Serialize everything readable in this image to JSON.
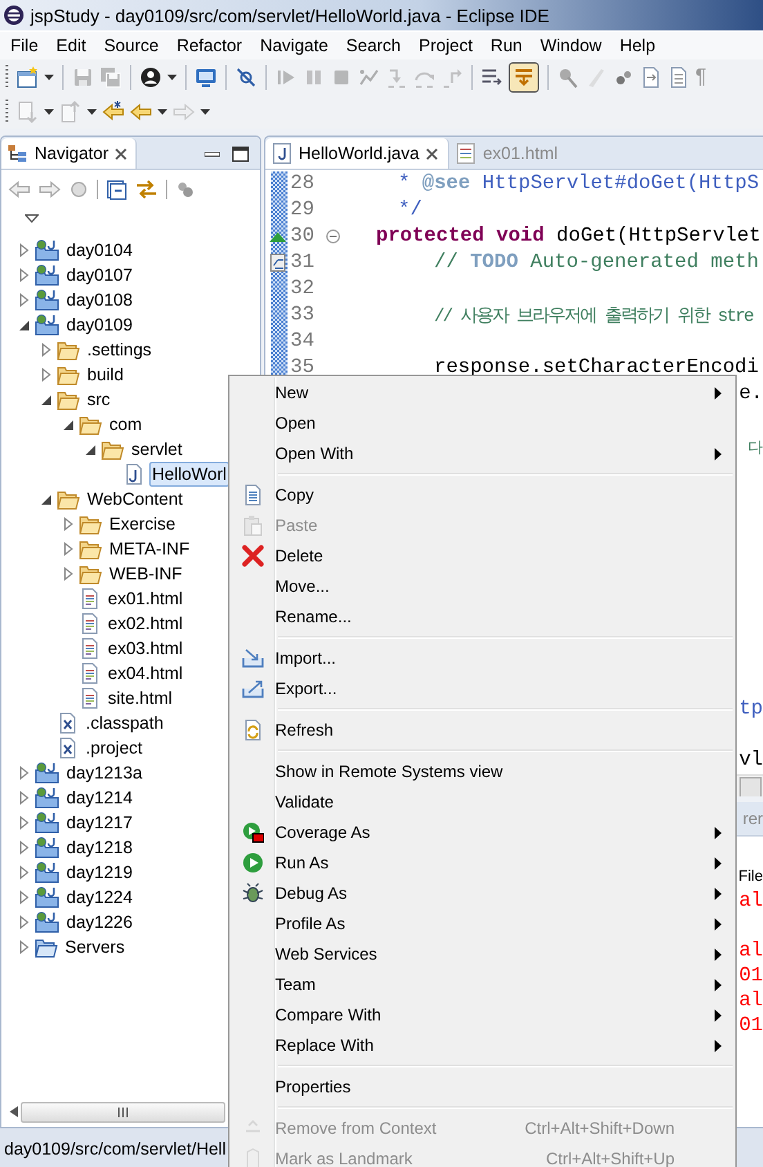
{
  "window": {
    "title": "jspStudy - day0109/src/com/servlet/HelloWorld.java - Eclipse IDE"
  },
  "menu_bar": [
    "File",
    "Edit",
    "Source",
    "Refactor",
    "Navigate",
    "Search",
    "Project",
    "Run",
    "Window",
    "Help"
  ],
  "toolbar_1": [
    {
      "kind": "button",
      "disabled": false,
      "pressed": false
    },
    {
      "kind": "dropdown"
    },
    {
      "kind": "separator"
    },
    {
      "kind": "button",
      "disabled": true,
      "pressed": false
    },
    {
      "kind": "button",
      "disabled": true,
      "pressed": false
    },
    {
      "kind": "separator"
    },
    {
      "kind": "button",
      "disabled": false,
      "pressed": false
    },
    {
      "kind": "dropdown"
    },
    {
      "kind": "separator"
    },
    {
      "kind": "button",
      "disabled": false,
      "pressed": false
    },
    {
      "kind": "separator"
    },
    {
      "kind": "button",
      "disabled": false,
      "pressed": false
    },
    {
      "kind": "separator"
    },
    {
      "kind": "button",
      "disabled": true,
      "pressed": false
    },
    {
      "kind": "button",
      "disabled": true,
      "pressed": false
    },
    {
      "kind": "button",
      "disabled": true,
      "pressed": false
    },
    {
      "kind": "button",
      "disabled": true,
      "pressed": false
    },
    {
      "kind": "button",
      "disabled": true,
      "pressed": false
    },
    {
      "kind": "button",
      "disabled": true,
      "pressed": false
    },
    {
      "kind": "button",
      "disabled": true,
      "pressed": false
    },
    {
      "kind": "separator"
    },
    {
      "kind": "button",
      "disabled": false,
      "pressed": false
    },
    {
      "kind": "button",
      "disabled": false,
      "pressed": true
    },
    {
      "kind": "separator"
    },
    {
      "kind": "button",
      "disabled": false,
      "pressed": false
    },
    {
      "kind": "button",
      "disabled": true,
      "pressed": false
    },
    {
      "kind": "button",
      "disabled": false,
      "pressed": false
    },
    {
      "kind": "button",
      "disabled": false,
      "pressed": false
    },
    {
      "kind": "button",
      "disabled": false,
      "pressed": false
    },
    {
      "kind": "glyph",
      "text": "¶"
    }
  ],
  "toolbar_2": [
    {
      "kind": "button",
      "disabled": true,
      "pressed": false
    },
    {
      "kind": "dropdown"
    },
    {
      "kind": "button",
      "disabled": true,
      "pressed": false
    },
    {
      "kind": "dropdown"
    },
    {
      "kind": "button",
      "disabled": false,
      "pressed": false
    },
    {
      "kind": "button",
      "disabled": false,
      "pressed": false
    },
    {
      "kind": "dropdown"
    },
    {
      "kind": "button",
      "disabled": true,
      "pressed": false
    },
    {
      "kind": "dropdown"
    }
  ],
  "navigator": {
    "title": "Navigator",
    "tree": [
      {
        "label": "day0104",
        "kind": "project",
        "expanded": false,
        "selected": false
      },
      {
        "label": "day0107",
        "kind": "project",
        "expanded": false,
        "selected": false
      },
      {
        "label": "day0108",
        "kind": "project",
        "expanded": false,
        "selected": false
      },
      {
        "label": "day0109",
        "kind": "project",
        "expanded": true,
        "selected": false,
        "children": [
          {
            "label": ".settings",
            "kind": "folder",
            "expanded": false,
            "selected": false
          },
          {
            "label": "build",
            "kind": "folder",
            "expanded": false,
            "selected": false
          },
          {
            "label": "src",
            "kind": "folder",
            "expanded": true,
            "selected": false,
            "children": [
              {
                "label": "com",
                "kind": "folder",
                "expanded": true,
                "selected": false,
                "children": [
                  {
                    "label": "servlet",
                    "kind": "folder",
                    "expanded": true,
                    "selected": false,
                    "children": [
                      {
                        "label": "HelloWorl",
                        "kind": "java",
                        "selected": true
                      }
                    ]
                  }
                ]
              }
            ]
          },
          {
            "label": "WebContent",
            "kind": "folder",
            "expanded": true,
            "selected": false,
            "children": [
              {
                "label": "Exercise",
                "kind": "folder",
                "expanded": false,
                "selected": false
              },
              {
                "label": "META-INF",
                "kind": "folder",
                "expanded": false,
                "selected": false
              },
              {
                "label": "WEB-INF",
                "kind": "folder",
                "expanded": false,
                "selected": false
              },
              {
                "label": "ex01.html",
                "kind": "html",
                "selected": false
              },
              {
                "label": "ex02.html",
                "kind": "html",
                "selected": false
              },
              {
                "label": "ex03.html",
                "kind": "html",
                "selected": false
              },
              {
                "label": "ex04.html",
                "kind": "html",
                "selected": false
              },
              {
                "label": "site.html",
                "kind": "html",
                "selected": false
              }
            ]
          },
          {
            "label": ".classpath",
            "kind": "xml",
            "selected": false
          },
          {
            "label": ".project",
            "kind": "xml",
            "selected": false
          }
        ]
      },
      {
        "label": "day1213a",
        "kind": "project",
        "expanded": false,
        "selected": false
      },
      {
        "label": "day1214",
        "kind": "project",
        "expanded": false,
        "selected": false
      },
      {
        "label": "day1217",
        "kind": "project",
        "expanded": false,
        "selected": false
      },
      {
        "label": "day1218",
        "kind": "project",
        "expanded": false,
        "selected": false
      },
      {
        "label": "day1219",
        "kind": "project",
        "expanded": false,
        "selected": false
      },
      {
        "label": "day1224",
        "kind": "project",
        "expanded": false,
        "selected": false
      },
      {
        "label": "day1226",
        "kind": "project",
        "expanded": false,
        "selected": false
      },
      {
        "label": "Servers",
        "kind": "servers",
        "expanded": false,
        "selected": false
      }
    ]
  },
  "editor": {
    "tabs": [
      {
        "label": "HelloWorld.java",
        "selected": true
      },
      {
        "label": "ex01.html",
        "selected": false
      }
    ],
    "lines": [
      {
        "number": "28",
        "kind": "javadoc",
        "code": "* **@see** HttpServlet#doGet(HttpS"
      },
      {
        "number": "29",
        "kind": "javadoc",
        "code": "*/"
      },
      {
        "number": "30",
        "kind": "declaration",
        "code": "**protected** **void** doGet(HttpServlet"
      },
      {
        "number": "31",
        "kind": "comment",
        "code": "// **TODO** Auto-generated meth"
      },
      {
        "number": "32",
        "kind": "blank"
      },
      {
        "number": "33",
        "kind": "localcomment",
        "code": "// 사용자 브라우저에 출력하기 위한 stre"
      },
      {
        "number": "34",
        "kind": "blank"
      },
      {
        "number": "35",
        "kind": "statement",
        "code": "response.setCharacterEncodi"
      },
      {
        "kind": "tailplain",
        "code": "e."
      },
      {
        "kind": "blank"
      },
      {
        "kind": "tailcomment",
        "code": "다"
      },
      {
        "kind": "blank"
      },
      {
        "kind": "blank"
      },
      {
        "kind": "blank"
      },
      {
        "kind": "blank"
      },
      {
        "kind": "blank"
      },
      {
        "kind": "blank"
      },
      {
        "kind": "blank"
      },
      {
        "kind": "blank"
      },
      {
        "kind": "blank"
      },
      {
        "kind": "tailjavadoc",
        "code": "tp"
      },
      {
        "kind": "blank"
      },
      {
        "kind": "tailplain",
        "code": "vl"
      }
    ]
  },
  "bottom_panel": {
    "tab": "rer",
    "rows": [
      {
        "kind": "header",
        "text": "File"
      },
      {
        "kind": "error",
        "text": "al"
      },
      {
        "kind": "blank"
      },
      {
        "kind": "error",
        "text": "al"
      },
      {
        "kind": "error",
        "text": "01"
      },
      {
        "kind": "error",
        "text": "al"
      },
      {
        "kind": "error",
        "text": "01"
      }
    ]
  },
  "context_menu": {
    "items": [
      {
        "kind": "item",
        "label": "New",
        "submenu": true,
        "disabled": false
      },
      {
        "kind": "item",
        "label": "Open",
        "submenu": false,
        "disabled": false
      },
      {
        "kind": "item",
        "label": "Open With",
        "submenu": true,
        "disabled": false
      },
      {
        "kind": "separator"
      },
      {
        "kind": "item",
        "label": "Copy",
        "submenu": false,
        "disabled": false
      },
      {
        "kind": "item",
        "label": "Paste",
        "submenu": false,
        "disabled": true
      },
      {
        "kind": "item",
        "label": "Delete",
        "submenu": false,
        "disabled": false
      },
      {
        "kind": "item",
        "label": "Move...",
        "submenu": false,
        "disabled": false
      },
      {
        "kind": "item",
        "label": "Rename...",
        "submenu": false,
        "disabled": false
      },
      {
        "kind": "separator"
      },
      {
        "kind": "item",
        "label": "Import...",
        "submenu": false,
        "disabled": false
      },
      {
        "kind": "item",
        "label": "Export...",
        "submenu": false,
        "disabled": false
      },
      {
        "kind": "separator"
      },
      {
        "kind": "item",
        "label": "Refresh",
        "submenu": false,
        "disabled": false
      },
      {
        "kind": "separator"
      },
      {
        "kind": "item",
        "label": "Show in Remote Systems view",
        "submenu": false,
        "disabled": false
      },
      {
        "kind": "item",
        "label": "Validate",
        "submenu": false,
        "disabled": false
      },
      {
        "kind": "item",
        "label": "Coverage As",
        "submenu": true,
        "disabled": false
      },
      {
        "kind": "item",
        "label": "Run As",
        "submenu": true,
        "disabled": false
      },
      {
        "kind": "item",
        "label": "Debug As",
        "submenu": true,
        "disabled": false
      },
      {
        "kind": "item",
        "label": "Profile As",
        "submenu": true,
        "disabled": false
      },
      {
        "kind": "item",
        "label": "Web Services",
        "submenu": true,
        "disabled": false
      },
      {
        "kind": "item",
        "label": "Team",
        "submenu": true,
        "disabled": false
      },
      {
        "kind": "item",
        "label": "Compare With",
        "submenu": true,
        "disabled": false
      },
      {
        "kind": "item",
        "label": "Replace With",
        "submenu": true,
        "disabled": false
      },
      {
        "kind": "separator"
      },
      {
        "kind": "item",
        "label": "Properties",
        "submenu": false,
        "disabled": false
      },
      {
        "kind": "separator"
      },
      {
        "kind": "item",
        "label": "Remove from Context",
        "submenu": false,
        "disabled": true,
        "shortcut": "Ctrl+Alt+Shift+Down"
      },
      {
        "kind": "item",
        "label": "Mark as Landmark",
        "submenu": false,
        "disabled": true,
        "shortcut": "Ctrl+Alt+Shift+Up"
      }
    ]
  },
  "status_bar": "day0109/src/com/servlet/Hell"
}
